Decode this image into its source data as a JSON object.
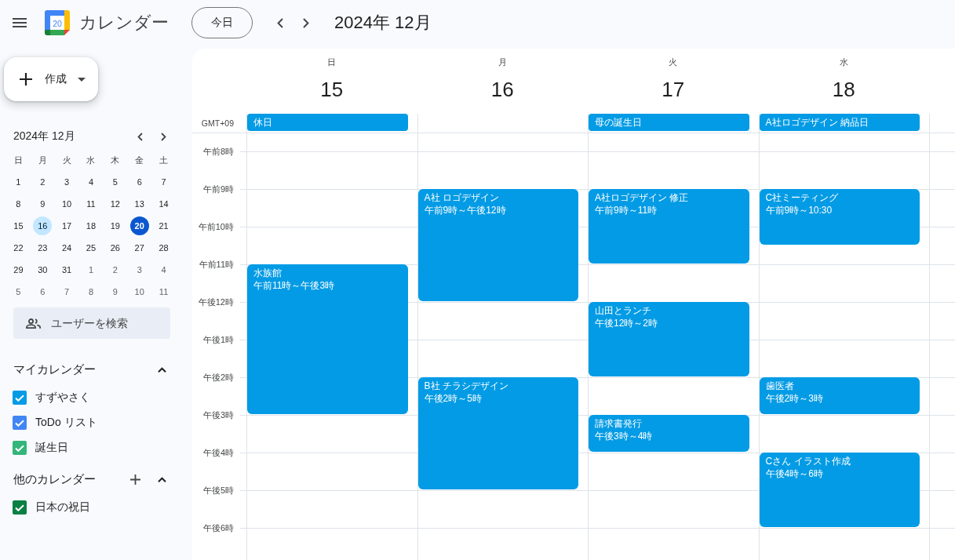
{
  "header": {
    "app_name": "カレンダー",
    "logo_date": "20",
    "today_button": "今日",
    "period_title": "2024年 12月"
  },
  "sidebar": {
    "create_button": "作成",
    "mini_calendar": {
      "title": "2024年 12月",
      "weekdays": [
        "日",
        "月",
        "火",
        "水",
        "木",
        "金",
        "土"
      ],
      "days": [
        {
          "label": "1",
          "in_month": true,
          "selected": false,
          "today": false
        },
        {
          "label": "2",
          "in_month": true,
          "selected": false,
          "today": false
        },
        {
          "label": "3",
          "in_month": true,
          "selected": false,
          "today": false
        },
        {
          "label": "4",
          "in_month": true,
          "selected": false,
          "today": false
        },
        {
          "label": "5",
          "in_month": true,
          "selected": false,
          "today": false
        },
        {
          "label": "6",
          "in_month": true,
          "selected": false,
          "today": false
        },
        {
          "label": "7",
          "in_month": true,
          "selected": false,
          "today": false
        },
        {
          "label": "8",
          "in_month": true,
          "selected": false,
          "today": false
        },
        {
          "label": "9",
          "in_month": true,
          "selected": false,
          "today": false
        },
        {
          "label": "10",
          "in_month": true,
          "selected": false,
          "today": false
        },
        {
          "label": "11",
          "in_month": true,
          "selected": false,
          "today": false
        },
        {
          "label": "12",
          "in_month": true,
          "selected": false,
          "today": false
        },
        {
          "label": "13",
          "in_month": true,
          "selected": false,
          "today": false
        },
        {
          "label": "14",
          "in_month": true,
          "selected": false,
          "today": false
        },
        {
          "label": "15",
          "in_month": true,
          "selected": false,
          "today": false
        },
        {
          "label": "16",
          "in_month": true,
          "selected": true,
          "today": false
        },
        {
          "label": "17",
          "in_month": true,
          "selected": false,
          "today": false
        },
        {
          "label": "18",
          "in_month": true,
          "selected": false,
          "today": false
        },
        {
          "label": "19",
          "in_month": true,
          "selected": false,
          "today": false
        },
        {
          "label": "20",
          "in_month": true,
          "selected": false,
          "today": true
        },
        {
          "label": "21",
          "in_month": true,
          "selected": false,
          "today": false
        },
        {
          "label": "22",
          "in_month": true,
          "selected": false,
          "today": false
        },
        {
          "label": "23",
          "in_month": true,
          "selected": false,
          "today": false
        },
        {
          "label": "24",
          "in_month": true,
          "selected": false,
          "today": false
        },
        {
          "label": "25",
          "in_month": true,
          "selected": false,
          "today": false
        },
        {
          "label": "26",
          "in_month": true,
          "selected": false,
          "today": false
        },
        {
          "label": "27",
          "in_month": true,
          "selected": false,
          "today": false
        },
        {
          "label": "28",
          "in_month": true,
          "selected": false,
          "today": false
        },
        {
          "label": "29",
          "in_month": true,
          "selected": false,
          "today": false
        },
        {
          "label": "30",
          "in_month": true,
          "selected": false,
          "today": false
        },
        {
          "label": "31",
          "in_month": true,
          "selected": false,
          "today": false
        },
        {
          "label": "1",
          "in_month": false,
          "selected": false,
          "today": false
        },
        {
          "label": "2",
          "in_month": false,
          "selected": false,
          "today": false
        },
        {
          "label": "3",
          "in_month": false,
          "selected": false,
          "today": false
        },
        {
          "label": "4",
          "in_month": false,
          "selected": false,
          "today": false
        },
        {
          "label": "5",
          "in_month": false,
          "selected": false,
          "today": false
        },
        {
          "label": "6",
          "in_month": false,
          "selected": false,
          "today": false
        },
        {
          "label": "7",
          "in_month": false,
          "selected": false,
          "today": false
        },
        {
          "label": "8",
          "in_month": false,
          "selected": false,
          "today": false
        },
        {
          "label": "9",
          "in_month": false,
          "selected": false,
          "today": false
        },
        {
          "label": "10",
          "in_month": false,
          "selected": false,
          "today": false
        },
        {
          "label": "11",
          "in_month": false,
          "selected": false,
          "today": false
        }
      ]
    },
    "people_search": {
      "placeholder": "ユーザーを検索"
    },
    "calendar_sections": [
      {
        "title": "マイカレンダー",
        "add_button": false,
        "expanded": true,
        "calendars": [
          {
            "label": "すずやさく",
            "checked": true,
            "color": "#039be5"
          },
          {
            "label": "ToDo リスト",
            "checked": true,
            "color": "#4285f4"
          },
          {
            "label": "誕生日",
            "checked": true,
            "color": "#33b679"
          }
        ]
      },
      {
        "title": "他のカレンダー",
        "add_button": true,
        "expanded": true,
        "calendars": [
          {
            "label": "日本の祝日",
            "checked": true,
            "color": "#0b8043"
          }
        ]
      }
    ]
  },
  "week_view": {
    "timezone": "GMT+09",
    "hours": [
      "午前8時",
      "午前9時",
      "午前10時",
      "午前11時",
      "午後12時",
      "午後1時",
      "午後2時",
      "午後3時",
      "午後4時",
      "午後5時",
      "午後6時"
    ],
    "days": [
      {
        "weekday": "日",
        "date": "15",
        "all_day": [
          {
            "title": "休日"
          }
        ],
        "events": [
          {
            "title": "水族館",
            "time": "午前11時～午後3時"
          }
        ]
      },
      {
        "weekday": "月",
        "date": "16",
        "events": [
          {
            "title": "A社 ロゴデザイン",
            "time": "午前9時～午後12時"
          },
          {
            "title": "B社 チラシデザイン",
            "time": "午後2時～5時"
          }
        ]
      },
      {
        "weekday": "火",
        "date": "17",
        "all_day": [
          {
            "title": "母の誕生日"
          }
        ],
        "events": [
          {
            "title": "A社ロゴデザイン 修正",
            "time": "午前9時～11時"
          },
          {
            "title": "山田とランチ",
            "time": "午後12時～2時"
          },
          {
            "title": "請求書発行",
            "time": "午後3時～4時"
          }
        ]
      },
      {
        "weekday": "水",
        "date": "18",
        "all_day": [
          {
            "title": "A社ロゴデザイン 納品日"
          }
        ],
        "events": [
          {
            "title": "C社ミーティング",
            "time": "午前9時～10:30"
          },
          {
            "title": "歯医者",
            "time": "午後2時～3時"
          },
          {
            "title": "Cさん イラスト作成",
            "time": "午後4時～6時"
          }
        ]
      }
    ]
  }
}
